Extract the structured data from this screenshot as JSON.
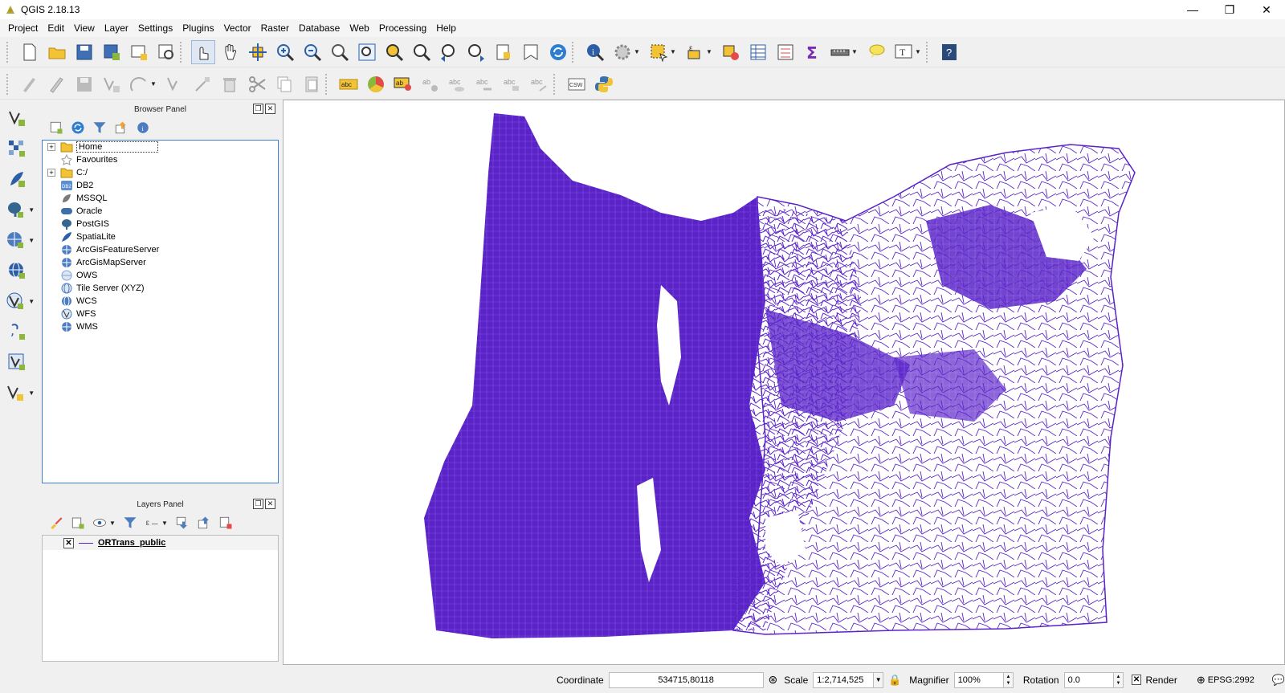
{
  "window": {
    "title": "QGIS 2.18.13",
    "minimize_glyph": "—",
    "restore_glyph": "❐",
    "close_glyph": "✕"
  },
  "menu": [
    "Project",
    "Edit",
    "View",
    "Layer",
    "Settings",
    "Plugins",
    "Vector",
    "Raster",
    "Database",
    "Web",
    "Processing",
    "Help"
  ],
  "browser_panel": {
    "title": "Browser Panel",
    "items": [
      {
        "label": "Home",
        "icon": "folder-icon",
        "expandable": true
      },
      {
        "label": "Favourites",
        "icon": "star-icon",
        "expandable": false
      },
      {
        "label": "C:/",
        "icon": "folder-icon",
        "expandable": true
      },
      {
        "label": "DB2",
        "icon": "db2-icon",
        "expandable": false
      },
      {
        "label": "MSSQL",
        "icon": "mssql-icon",
        "expandable": false
      },
      {
        "label": "Oracle",
        "icon": "oracle-icon",
        "expandable": false
      },
      {
        "label": "PostGIS",
        "icon": "postgis-elephant-icon",
        "expandable": false
      },
      {
        "label": "SpatiaLite",
        "icon": "spatialite-feather-icon",
        "expandable": false
      },
      {
        "label": "ArcGisFeatureServer",
        "icon": "arcgis-globe-icon",
        "expandable": false
      },
      {
        "label": "ArcGisMapServer",
        "icon": "arcgis-globe-icon",
        "expandable": false
      },
      {
        "label": "OWS",
        "icon": "globe-icon",
        "expandable": false
      },
      {
        "label": "Tile Server (XYZ)",
        "icon": "globe-icon",
        "expandable": false
      },
      {
        "label": "WCS",
        "icon": "globe-icon",
        "expandable": false
      },
      {
        "label": "WFS",
        "icon": "globe-icon",
        "expandable": false
      },
      {
        "label": "WMS",
        "icon": "globe-icon",
        "expandable": false
      }
    ]
  },
  "layers_panel": {
    "title": "Layers Panel",
    "layers": [
      {
        "name": "ORTrans_public",
        "visible": true,
        "color": "#5a23c8"
      }
    ]
  },
  "map": {
    "line_color": "#5a23c8"
  },
  "status": {
    "coordinate_label": "Coordinate",
    "coordinate_value": "534715,80118",
    "scale_label": "Scale",
    "scale_value": "1:2,714,525",
    "magnifier_label": "Magnifier",
    "magnifier_value": "100%",
    "rotation_label": "Rotation",
    "rotation_value": "0.0",
    "render_label": "Render",
    "crs_label": "EPSG:2992"
  }
}
